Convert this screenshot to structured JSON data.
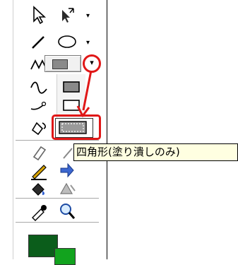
{
  "toolbox": {
    "tools": [
      {
        "icon": "pointer-arrow-icon"
      },
      {
        "icon": "subselect-icon"
      },
      {
        "icon": "line-tool-icon"
      },
      {
        "icon": "ellipse-tool-icon"
      },
      {
        "icon": "polyline-tool-icon"
      },
      {
        "icon": "rectangle-tool-icon"
      },
      {
        "icon": "freeform-tool-icon"
      },
      {
        "icon": "pen-tool-icon"
      },
      {
        "icon": "paint-bucket-shape-icon"
      },
      {
        "icon": "eraser-icon"
      },
      {
        "icon": "brush-tool-icon"
      },
      {
        "icon": "fill-bucket-icon"
      },
      {
        "icon": "transform-icon"
      },
      {
        "icon": "eyedropper-icon"
      },
      {
        "icon": "magnifier-icon"
      }
    ],
    "flyout": {
      "options": [
        {
          "icon": "rectangle-filled-icon"
        },
        {
          "icon": "rectangle-outline-icon"
        },
        {
          "icon": "rectangle-fill-only-icon"
        }
      ]
    },
    "colors": {
      "foreground": "#0b5d1b",
      "background": "#12a31e"
    },
    "tooltip_text": "四角形(塗り潰しのみ)",
    "dropdown_caret": "▾",
    "annotation_color": "#e01717"
  }
}
